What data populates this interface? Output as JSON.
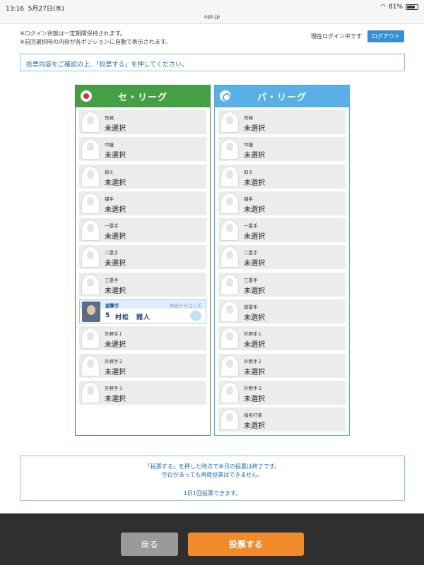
{
  "status": {
    "time": "13:16",
    "date": "5月27日(水)",
    "url": "npb.jp",
    "battery": "81%",
    "battery_level": 0.81
  },
  "notes": [
    "※ログイン状態は一定期間保持されます。",
    "※前回選択時の内容が各ポジションに自動で表示されます。"
  ],
  "login": {
    "status": "現在ログイン中です",
    "logout": "ログアウト"
  },
  "confirm_text": "投票内容をご確認の上、「投票する」を押してください。",
  "central": {
    "title": "セ・リーグ",
    "slots": [
      {
        "pos": "先発",
        "val": "未選択"
      },
      {
        "pos": "中継",
        "val": "未選択"
      },
      {
        "pos": "抑え",
        "val": "未選択"
      },
      {
        "pos": "捕手",
        "val": "未選択"
      },
      {
        "pos": "一塁手",
        "val": "未選択"
      },
      {
        "pos": "二塁手",
        "val": "未選択"
      },
      {
        "pos": "三塁手",
        "val": "未選択"
      },
      {
        "pos": "遊撃手",
        "team": "中日ドラゴンズ",
        "num": "5",
        "name": "村松　開人"
      },
      {
        "pos": "外野手１",
        "val": "未選択"
      },
      {
        "pos": "外野手２",
        "val": "未選択"
      },
      {
        "pos": "外野手３",
        "val": "未選択"
      }
    ]
  },
  "pacific": {
    "title": "パ・リーグ",
    "slots": [
      {
        "pos": "先発",
        "val": "未選択"
      },
      {
        "pos": "中継",
        "val": "未選択"
      },
      {
        "pos": "抑え",
        "val": "未選択"
      },
      {
        "pos": "捕手",
        "val": "未選択"
      },
      {
        "pos": "一塁手",
        "val": "未選択"
      },
      {
        "pos": "二塁手",
        "val": "未選択"
      },
      {
        "pos": "三塁手",
        "val": "未選択"
      },
      {
        "pos": "遊撃手",
        "val": "未選択"
      },
      {
        "pos": "外野手１",
        "val": "未選択"
      },
      {
        "pos": "外野手２",
        "val": "未選択"
      },
      {
        "pos": "外野手３",
        "val": "未選択"
      },
      {
        "pos": "指名打者",
        "val": "未選択"
      }
    ]
  },
  "info": {
    "line1": "「投票する」を押した時点で本日の投票は終了です。",
    "line2": "空白があっても再度投票はできません。",
    "line3": "1日1回投票できます。"
  },
  "footer": {
    "back": "戻る",
    "vote": "投票する"
  }
}
